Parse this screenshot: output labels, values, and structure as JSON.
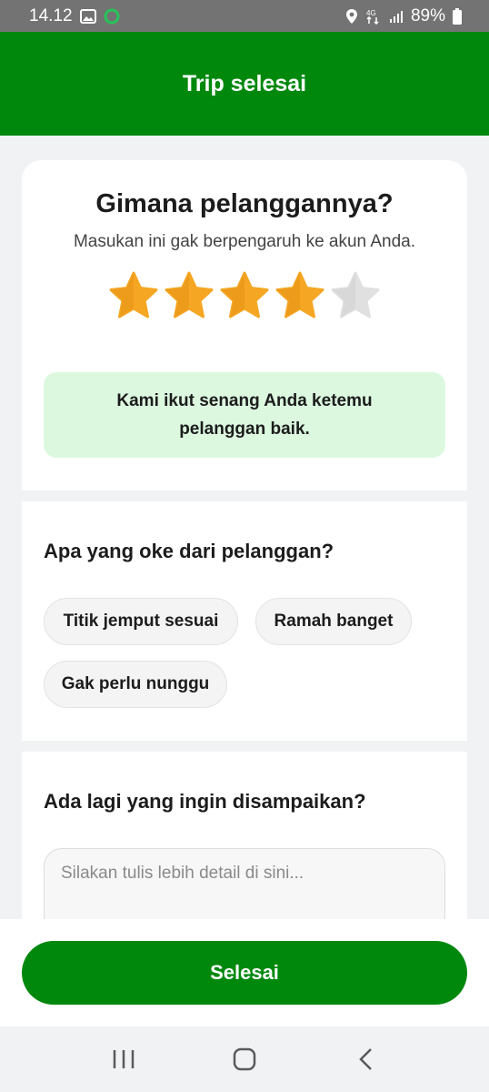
{
  "status_bar": {
    "time": "14.12",
    "battery": "89%",
    "network": "4G"
  },
  "header": {
    "title": "Trip selesai"
  },
  "rating": {
    "title": "Gimana pelanggannya?",
    "subtitle": "Masukan ini gak berpengaruh ke akun Anda.",
    "stars_filled": 4,
    "stars_total": 5,
    "message": "Kami ikut senang Anda ketemu pelanggan baik."
  },
  "compliments": {
    "title": "Apa yang oke dari pelanggan?",
    "chips": [
      "Titik jemput sesuai",
      "Ramah banget",
      "Gak perlu nunggu"
    ]
  },
  "feedback": {
    "title": "Ada lagi yang ingin disampaikan?",
    "placeholder": "Silakan tulis lebih detail di sini...",
    "value": ""
  },
  "actions": {
    "done_label": "Selesai"
  },
  "colors": {
    "brand_green": "#00880d",
    "star_filled": "#f5a623",
    "star_empty": "#e0e0e0",
    "banner_bg": "#dcf9e0"
  },
  "icons": {
    "status_left": [
      "gallery-icon",
      "app-notification-icon"
    ],
    "status_right": [
      "location-icon",
      "data-arrows-icon",
      "signal-icon",
      "battery-icon"
    ],
    "nav": [
      "recent-apps-icon",
      "home-icon",
      "back-icon"
    ]
  }
}
